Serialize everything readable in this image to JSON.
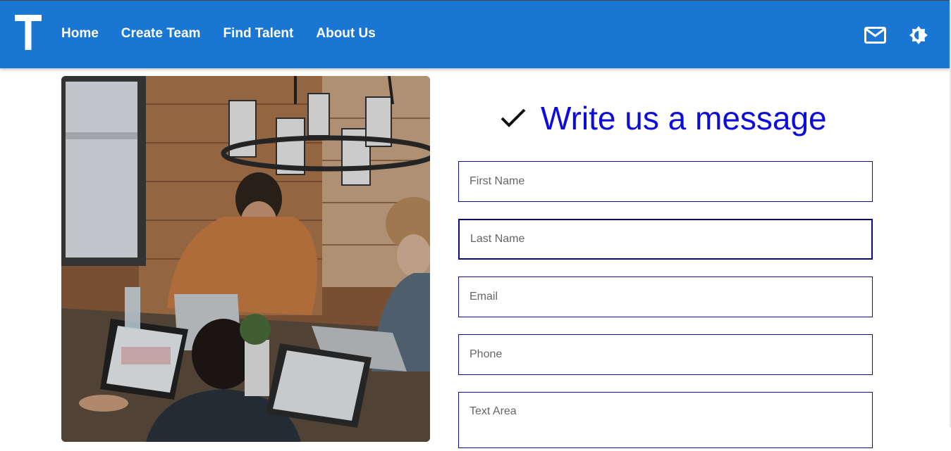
{
  "app": {
    "logo_letter": "T",
    "brand_color": "#1976d2",
    "accent_color": "#0d0ddb"
  },
  "nav": {
    "items": [
      {
        "label": "Home"
      },
      {
        "label": "Create Team"
      },
      {
        "label": "Find Talent"
      },
      {
        "label": "About Us"
      }
    ]
  },
  "appbar_icons": {
    "mail": "mail-icon",
    "theme": "brightness-icon"
  },
  "photo": {
    "subject": "team working on laptops around a wooden table"
  },
  "form": {
    "heading_icon": "check-icon",
    "heading": "Write us a message",
    "fields": [
      {
        "placeholder": "First Name",
        "value": ""
      },
      {
        "placeholder": "Last Name",
        "value": ""
      },
      {
        "placeholder": "Email",
        "value": ""
      },
      {
        "placeholder": "Phone",
        "value": ""
      },
      {
        "placeholder": "Text Area",
        "value": ""
      }
    ]
  }
}
